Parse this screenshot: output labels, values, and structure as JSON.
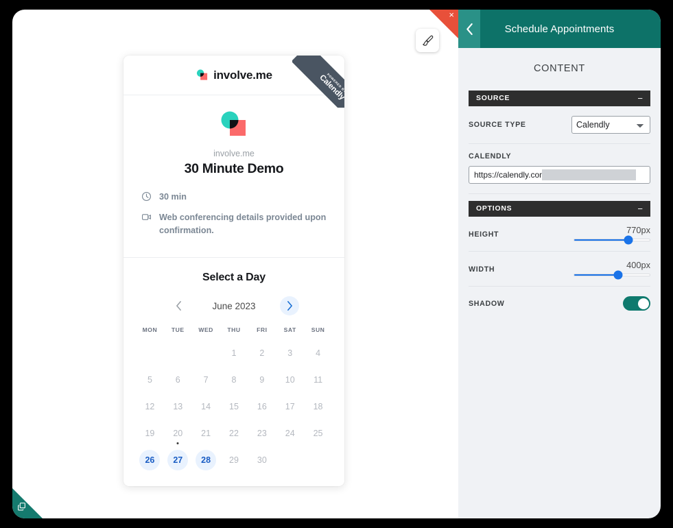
{
  "canvas": {
    "brush_icon": "paintbrush-icon",
    "close_icon": "close-icon",
    "close_label": "×",
    "corner_handle_icon": "duplicate-icon"
  },
  "embed_card": {
    "brand": {
      "name": "involve.me",
      "logo_icon": "involveme-logo-icon"
    },
    "ribbon": {
      "powered_by": "POWERED BY",
      "provider": "Calendly"
    },
    "event": {
      "organization": "involve.me",
      "title": "30 Minute Demo",
      "duration_icon": "clock-icon",
      "duration": "30 min",
      "location_icon": "video-camera-icon",
      "location": "Web conferencing details provided upon confirmation."
    },
    "calendar": {
      "heading": "Select a Day",
      "month_label": "June 2023",
      "prev_icon": "chevron-left-icon",
      "next_icon": "chevron-right-icon",
      "weekdays": [
        "MON",
        "TUE",
        "WED",
        "THU",
        "FRI",
        "SAT",
        "SUN"
      ],
      "leading_blanks": 3,
      "days": [
        {
          "n": "1",
          "available": false,
          "today": false
        },
        {
          "n": "2",
          "available": false,
          "today": false
        },
        {
          "n": "3",
          "available": false,
          "today": false
        },
        {
          "n": "4",
          "available": false,
          "today": false
        },
        {
          "n": "5",
          "available": false,
          "today": false
        },
        {
          "n": "6",
          "available": false,
          "today": false
        },
        {
          "n": "7",
          "available": false,
          "today": false
        },
        {
          "n": "8",
          "available": false,
          "today": false
        },
        {
          "n": "9",
          "available": false,
          "today": false
        },
        {
          "n": "10",
          "available": false,
          "today": false
        },
        {
          "n": "11",
          "available": false,
          "today": false
        },
        {
          "n": "12",
          "available": false,
          "today": false
        },
        {
          "n": "13",
          "available": false,
          "today": false
        },
        {
          "n": "14",
          "available": false,
          "today": false
        },
        {
          "n": "15",
          "available": false,
          "today": false
        },
        {
          "n": "16",
          "available": false,
          "today": false
        },
        {
          "n": "17",
          "available": false,
          "today": false
        },
        {
          "n": "18",
          "available": false,
          "today": false
        },
        {
          "n": "19",
          "available": false,
          "today": false
        },
        {
          "n": "20",
          "available": false,
          "today": true
        },
        {
          "n": "21",
          "available": false,
          "today": false
        },
        {
          "n": "22",
          "available": false,
          "today": false
        },
        {
          "n": "23",
          "available": false,
          "today": false
        },
        {
          "n": "24",
          "available": false,
          "today": false
        },
        {
          "n": "25",
          "available": false,
          "today": false
        },
        {
          "n": "26",
          "available": true,
          "today": false
        },
        {
          "n": "27",
          "available": true,
          "today": false
        },
        {
          "n": "28",
          "available": true,
          "today": false
        },
        {
          "n": "29",
          "available": false,
          "today": false
        },
        {
          "n": "30",
          "available": false,
          "today": false
        }
      ]
    }
  },
  "settings_panel": {
    "back_icon": "chevron-left-icon",
    "title": "Schedule Appointments",
    "subtitle": "CONTENT",
    "collapse_glyph": "−",
    "sections": {
      "source": {
        "label": "SOURCE",
        "source_type_label": "SOURCE TYPE",
        "source_type_value": "Calendly",
        "source_type_options": [
          "Calendly"
        ],
        "calendly_label": "CALENDLY",
        "calendly_value": "https://calendly.com/i",
        "calendly_placeholder": "https://calendly.com/"
      },
      "options": {
        "label": "OPTIONS",
        "height_label": "HEIGHT",
        "height_value": "770px",
        "height_percent": 72,
        "width_label": "WIDTH",
        "width_value": "400px",
        "width_percent": 58,
        "shadow_label": "SHADOW",
        "shadow_on": true
      }
    }
  },
  "colors": {
    "panel_header_teal": "#0d7268",
    "panel_back_teal": "#2a9187",
    "panel_bg": "#f0f2f5",
    "section_bar": "#2e2e2e",
    "slider_blue": "#1a73e8",
    "toggle_teal": "#0f7a6e",
    "available_day_blue": "#1a5dc4",
    "available_day_bg": "#e9f2fe",
    "ribbon_gray": "#4a5562",
    "close_red": "#e8503a",
    "brand_teal": "#2ad2bd",
    "brand_red": "#fb6a6a"
  }
}
